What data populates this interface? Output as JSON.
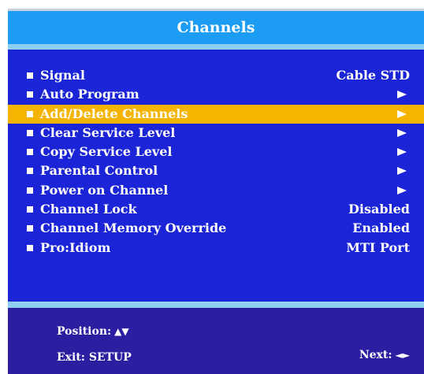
{
  "title": "Channels",
  "menu": {
    "items": [
      {
        "label": "Signal",
        "value": "Cable STD"
      },
      {
        "label": "Auto Program",
        "value": ""
      },
      {
        "label": "Add/Delete Channels",
        "value": ""
      },
      {
        "label": "Clear Service Level",
        "value": ""
      },
      {
        "label": "Copy Service Level",
        "value": ""
      },
      {
        "label": "Parental Control",
        "value": ""
      },
      {
        "label": "Power on Channel",
        "value": ""
      },
      {
        "label": "Channel Lock",
        "value": "Disabled"
      },
      {
        "label": "Channel Memory Override",
        "value": "Enabled"
      },
      {
        "label": "Pro:Idiom",
        "value": "MTI Port"
      }
    ],
    "highlighted_index": 2
  },
  "footer": {
    "position_label": "Position:",
    "position_glyph": "▲▼",
    "exit_label": "Exit: SETUP",
    "next_label": "Next:",
    "next_glyph": "◄►"
  },
  "icons": {
    "submenu": "right-arrow-icon",
    "bullet": "square-bullet-icon"
  },
  "colors": {
    "title_bar": "#1c9cf3",
    "menu_background": "#1b24d6",
    "highlight": "#f4b400",
    "footer_background": "#2b1ea0",
    "separator": "#8fd0f2",
    "text": "#ffffff"
  }
}
